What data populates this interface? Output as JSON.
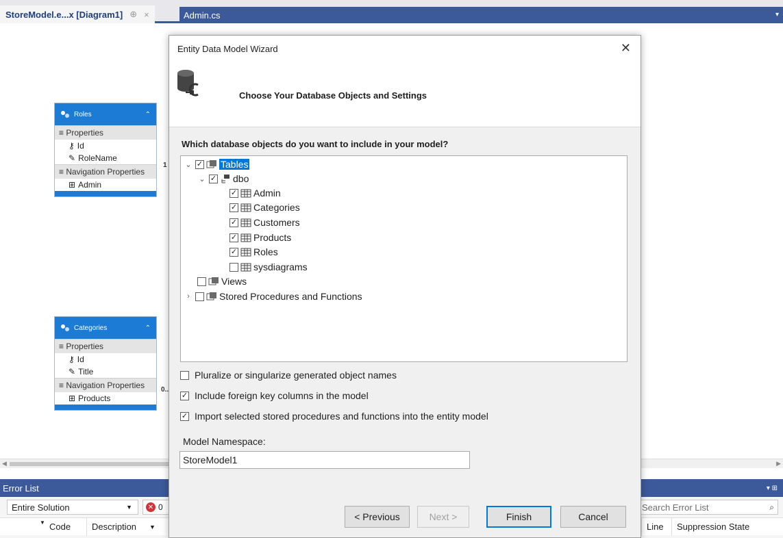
{
  "tabs": {
    "active_title": "StoreModel.e...x [Diagram1]",
    "active_pin": "⊕",
    "active_close": "×",
    "second_title": "Admin.cs"
  },
  "designer": {
    "roles_entity": {
      "name": "Roles",
      "properties_header": "Properties",
      "properties": [
        "Id",
        "RoleName"
      ],
      "nav_header": "Navigation Properties",
      "nav": [
        "Admin"
      ],
      "multiplicity": "1"
    },
    "categories_entity": {
      "name": "Categories",
      "properties_header": "Properties",
      "properties": [
        "Id",
        "Title"
      ],
      "nav_header": "Navigation Properties",
      "nav": [
        "Products"
      ],
      "multiplicity": "0.."
    }
  },
  "error_list": {
    "title": "Error List",
    "scope": "Entire Solution",
    "error_count": "0",
    "search_placeholder": "Search Error List",
    "columns": {
      "code": "Code",
      "description": "Description",
      "line": "Line",
      "suppression": "Suppression State"
    }
  },
  "wizard": {
    "title": "Entity Data Model Wizard",
    "heading": "Choose Your Database Objects and Settings",
    "question": "Which database objects do you want to include in your model?",
    "tree": {
      "tables": "Tables",
      "dbo": "dbo",
      "tables_list": [
        "Admin",
        "Categories",
        "Customers",
        "Products",
        "Roles",
        "sysdiagrams"
      ],
      "views": "Views",
      "stored_procs": "Stored Procedures and Functions"
    },
    "options": {
      "pluralize": "Pluralize or singularize generated object names",
      "foreign_keys": "Include foreign key columns in the model",
      "import_procs": "Import selected stored procedures and functions into the entity model"
    },
    "namespace_label": "Model Namespace:",
    "namespace_value": "StoreModel1",
    "buttons": {
      "previous": "< Previous",
      "next": "Next >",
      "finish": "Finish",
      "cancel": "Cancel"
    }
  },
  "colors": {
    "vs_blue": "#3c5a99",
    "entity_blue": "#1c7cd5",
    "selection": "#0078d7",
    "error_red": "#d13438"
  }
}
